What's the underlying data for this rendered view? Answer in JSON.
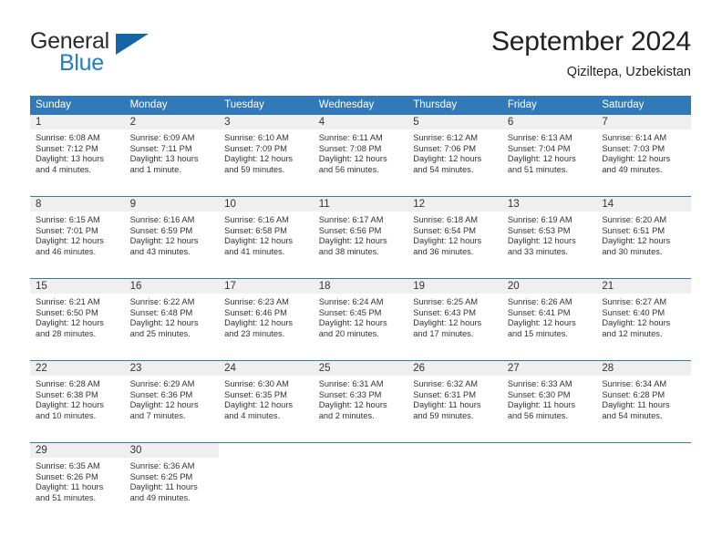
{
  "brand": {
    "line1": "General",
    "line2": "Blue",
    "mark": "triangle-logo"
  },
  "header": {
    "title": "September 2024",
    "location": "Qiziltepa, Uzbekistan"
  },
  "colors": {
    "header_blue": "#3179b9",
    "brand_blue": "#1f7fc4",
    "daynum_band": "#efefef",
    "text": "#333333"
  },
  "weekdays": [
    "Sunday",
    "Monday",
    "Tuesday",
    "Wednesday",
    "Thursday",
    "Friday",
    "Saturday"
  ],
  "weeks": [
    [
      {
        "day": "1",
        "sunrise": "Sunrise: 6:08 AM",
        "sunset": "Sunset: 7:12 PM",
        "daylight1": "Daylight: 13 hours",
        "daylight2": "and 4 minutes."
      },
      {
        "day": "2",
        "sunrise": "Sunrise: 6:09 AM",
        "sunset": "Sunset: 7:11 PM",
        "daylight1": "Daylight: 13 hours",
        "daylight2": "and 1 minute."
      },
      {
        "day": "3",
        "sunrise": "Sunrise: 6:10 AM",
        "sunset": "Sunset: 7:09 PM",
        "daylight1": "Daylight: 12 hours",
        "daylight2": "and 59 minutes."
      },
      {
        "day": "4",
        "sunrise": "Sunrise: 6:11 AM",
        "sunset": "Sunset: 7:08 PM",
        "daylight1": "Daylight: 12 hours",
        "daylight2": "and 56 minutes."
      },
      {
        "day": "5",
        "sunrise": "Sunrise: 6:12 AM",
        "sunset": "Sunset: 7:06 PM",
        "daylight1": "Daylight: 12 hours",
        "daylight2": "and 54 minutes."
      },
      {
        "day": "6",
        "sunrise": "Sunrise: 6:13 AM",
        "sunset": "Sunset: 7:04 PM",
        "daylight1": "Daylight: 12 hours",
        "daylight2": "and 51 minutes."
      },
      {
        "day": "7",
        "sunrise": "Sunrise: 6:14 AM",
        "sunset": "Sunset: 7:03 PM",
        "daylight1": "Daylight: 12 hours",
        "daylight2": "and 49 minutes."
      }
    ],
    [
      {
        "day": "8",
        "sunrise": "Sunrise: 6:15 AM",
        "sunset": "Sunset: 7:01 PM",
        "daylight1": "Daylight: 12 hours",
        "daylight2": "and 46 minutes."
      },
      {
        "day": "9",
        "sunrise": "Sunrise: 6:16 AM",
        "sunset": "Sunset: 6:59 PM",
        "daylight1": "Daylight: 12 hours",
        "daylight2": "and 43 minutes."
      },
      {
        "day": "10",
        "sunrise": "Sunrise: 6:16 AM",
        "sunset": "Sunset: 6:58 PM",
        "daylight1": "Daylight: 12 hours",
        "daylight2": "and 41 minutes."
      },
      {
        "day": "11",
        "sunrise": "Sunrise: 6:17 AM",
        "sunset": "Sunset: 6:56 PM",
        "daylight1": "Daylight: 12 hours",
        "daylight2": "and 38 minutes."
      },
      {
        "day": "12",
        "sunrise": "Sunrise: 6:18 AM",
        "sunset": "Sunset: 6:54 PM",
        "daylight1": "Daylight: 12 hours",
        "daylight2": "and 36 minutes."
      },
      {
        "day": "13",
        "sunrise": "Sunrise: 6:19 AM",
        "sunset": "Sunset: 6:53 PM",
        "daylight1": "Daylight: 12 hours",
        "daylight2": "and 33 minutes."
      },
      {
        "day": "14",
        "sunrise": "Sunrise: 6:20 AM",
        "sunset": "Sunset: 6:51 PM",
        "daylight1": "Daylight: 12 hours",
        "daylight2": "and 30 minutes."
      }
    ],
    [
      {
        "day": "15",
        "sunrise": "Sunrise: 6:21 AM",
        "sunset": "Sunset: 6:50 PM",
        "daylight1": "Daylight: 12 hours",
        "daylight2": "and 28 minutes."
      },
      {
        "day": "16",
        "sunrise": "Sunrise: 6:22 AM",
        "sunset": "Sunset: 6:48 PM",
        "daylight1": "Daylight: 12 hours",
        "daylight2": "and 25 minutes."
      },
      {
        "day": "17",
        "sunrise": "Sunrise: 6:23 AM",
        "sunset": "Sunset: 6:46 PM",
        "daylight1": "Daylight: 12 hours",
        "daylight2": "and 23 minutes."
      },
      {
        "day": "18",
        "sunrise": "Sunrise: 6:24 AM",
        "sunset": "Sunset: 6:45 PM",
        "daylight1": "Daylight: 12 hours",
        "daylight2": "and 20 minutes."
      },
      {
        "day": "19",
        "sunrise": "Sunrise: 6:25 AM",
        "sunset": "Sunset: 6:43 PM",
        "daylight1": "Daylight: 12 hours",
        "daylight2": "and 17 minutes."
      },
      {
        "day": "20",
        "sunrise": "Sunrise: 6:26 AM",
        "sunset": "Sunset: 6:41 PM",
        "daylight1": "Daylight: 12 hours",
        "daylight2": "and 15 minutes."
      },
      {
        "day": "21",
        "sunrise": "Sunrise: 6:27 AM",
        "sunset": "Sunset: 6:40 PM",
        "daylight1": "Daylight: 12 hours",
        "daylight2": "and 12 minutes."
      }
    ],
    [
      {
        "day": "22",
        "sunrise": "Sunrise: 6:28 AM",
        "sunset": "Sunset: 6:38 PM",
        "daylight1": "Daylight: 12 hours",
        "daylight2": "and 10 minutes."
      },
      {
        "day": "23",
        "sunrise": "Sunrise: 6:29 AM",
        "sunset": "Sunset: 6:36 PM",
        "daylight1": "Daylight: 12 hours",
        "daylight2": "and 7 minutes."
      },
      {
        "day": "24",
        "sunrise": "Sunrise: 6:30 AM",
        "sunset": "Sunset: 6:35 PM",
        "daylight1": "Daylight: 12 hours",
        "daylight2": "and 4 minutes."
      },
      {
        "day": "25",
        "sunrise": "Sunrise: 6:31 AM",
        "sunset": "Sunset: 6:33 PM",
        "daylight1": "Daylight: 12 hours",
        "daylight2": "and 2 minutes."
      },
      {
        "day": "26",
        "sunrise": "Sunrise: 6:32 AM",
        "sunset": "Sunset: 6:31 PM",
        "daylight1": "Daylight: 11 hours",
        "daylight2": "and 59 minutes."
      },
      {
        "day": "27",
        "sunrise": "Sunrise: 6:33 AM",
        "sunset": "Sunset: 6:30 PM",
        "daylight1": "Daylight: 11 hours",
        "daylight2": "and 56 minutes."
      },
      {
        "day": "28",
        "sunrise": "Sunrise: 6:34 AM",
        "sunset": "Sunset: 6:28 PM",
        "daylight1": "Daylight: 11 hours",
        "daylight2": "and 54 minutes."
      }
    ],
    [
      {
        "day": "29",
        "sunrise": "Sunrise: 6:35 AM",
        "sunset": "Sunset: 6:26 PM",
        "daylight1": "Daylight: 11 hours",
        "daylight2": "and 51 minutes."
      },
      {
        "day": "30",
        "sunrise": "Sunrise: 6:36 AM",
        "sunset": "Sunset: 6:25 PM",
        "daylight1": "Daylight: 11 hours",
        "daylight2": "and 49 minutes."
      },
      {
        "day": "",
        "sunrise": "",
        "sunset": "",
        "daylight1": "",
        "daylight2": ""
      },
      {
        "day": "",
        "sunrise": "",
        "sunset": "",
        "daylight1": "",
        "daylight2": ""
      },
      {
        "day": "",
        "sunrise": "",
        "sunset": "",
        "daylight1": "",
        "daylight2": ""
      },
      {
        "day": "",
        "sunrise": "",
        "sunset": "",
        "daylight1": "",
        "daylight2": ""
      },
      {
        "day": "",
        "sunrise": "",
        "sunset": "",
        "daylight1": "",
        "daylight2": ""
      }
    ]
  ]
}
